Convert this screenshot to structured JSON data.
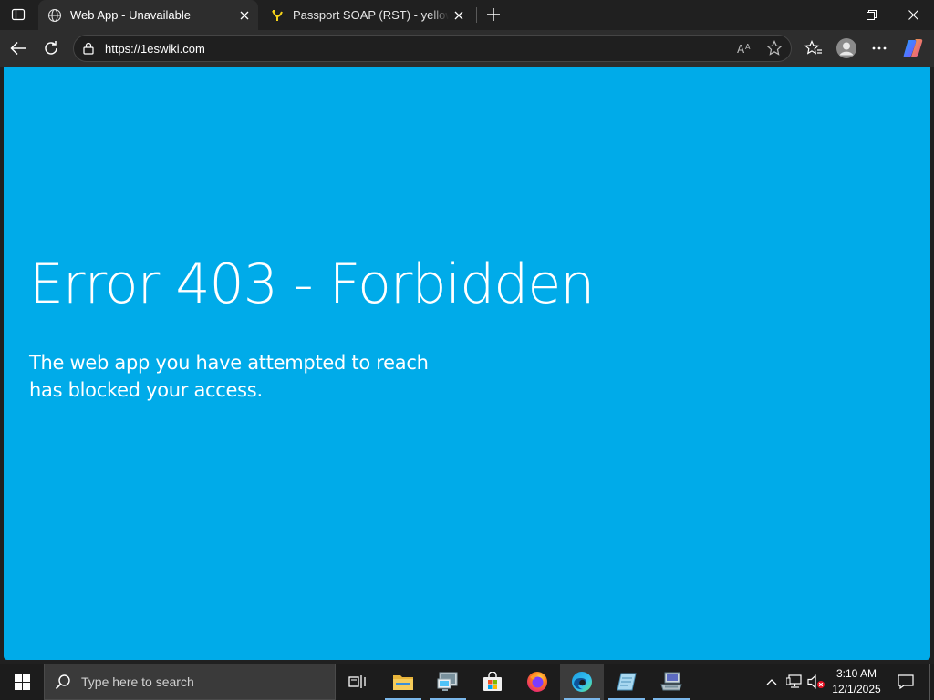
{
  "browser": {
    "tabs": [
      {
        "title": "Web App - Unavailable",
        "active": true,
        "favicon": "globe-icon"
      },
      {
        "title": "Passport SOAP (RST) - yellows' MSN",
        "active": false,
        "favicon": "yellow-pin-icon"
      }
    ],
    "address": {
      "url": "https://1eswiki.com"
    }
  },
  "page": {
    "background_color": "#00abe9",
    "error_title": "Error 403 - Forbidden",
    "error_message": "The web app you have attempted to reach has blocked your access."
  },
  "taskbar": {
    "search_placeholder": "Type here to search",
    "apps": [
      "task-view-icon",
      "file-explorer-icon",
      "remote-desktop-icon",
      "microsoft-store-icon",
      "firefox-icon",
      "edge-icon",
      "notepad-icon",
      "network-tool-icon"
    ],
    "clock": {
      "time": "3:10 AM",
      "date": "12/1/2025"
    }
  },
  "colors": {
    "titlebar": "#202020",
    "toolbar": "#2d2d2d",
    "accent_underline": "#7ab7ea",
    "taskbar": "#1c1c1c"
  }
}
